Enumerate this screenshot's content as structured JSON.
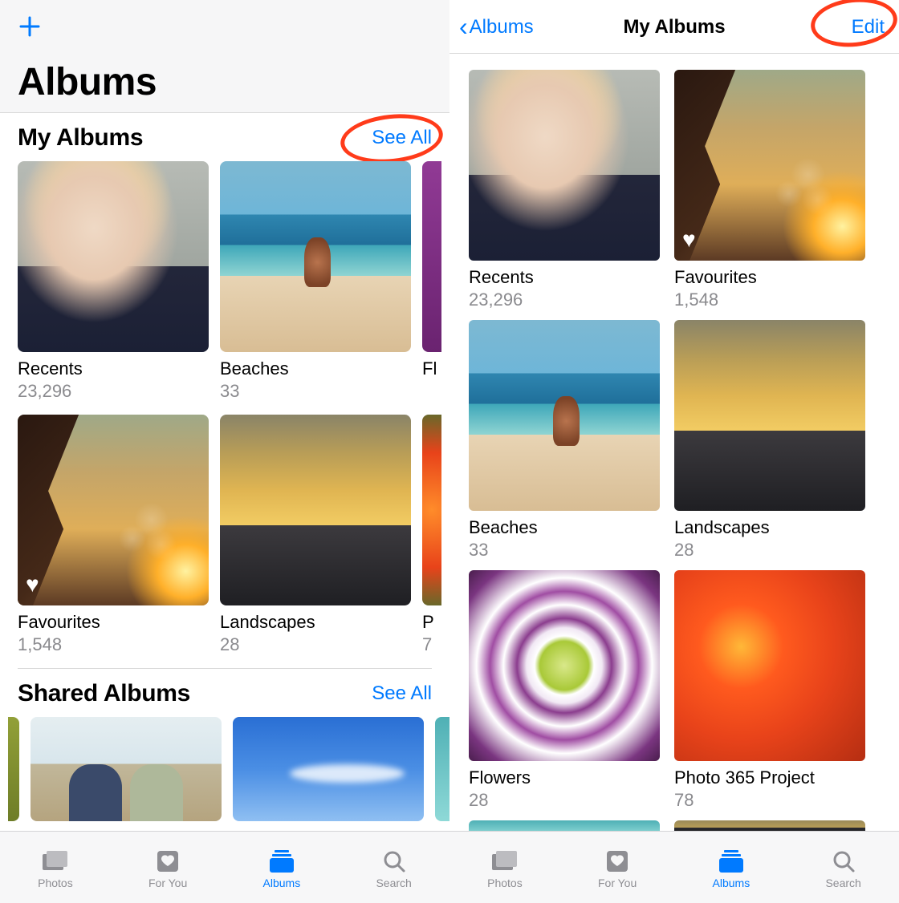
{
  "colors": {
    "accent": "#007aff",
    "annotation": "#ff3b1a",
    "muted": "#8e8e93"
  },
  "left": {
    "header_title": "Albums",
    "sections": {
      "my_albums": {
        "title": "My Albums",
        "see_all": "See All",
        "row1": [
          {
            "name": "Recents",
            "count": "23,296",
            "img": "img-portrait"
          },
          {
            "name": "Beaches",
            "count": "33",
            "img": "img-beach"
          },
          {
            "name_partial": "Fl",
            "count_partial": "",
            "img": "img-purple"
          }
        ],
        "row2": [
          {
            "name": "Favourites",
            "count": "1,548",
            "img": "img-fav",
            "heart": true
          },
          {
            "name": "Landscapes",
            "count": "28",
            "img": "img-land"
          },
          {
            "name_partial": "P",
            "count_partial": "7",
            "img": "img-oliveflower"
          }
        ]
      },
      "shared": {
        "title": "Shared Albums",
        "see_all": "See All"
      }
    }
  },
  "right": {
    "back_label": "Albums",
    "nav_title": "My Albums",
    "edit_label": "Edit",
    "albums": [
      {
        "name": "Recents",
        "count": "23,296",
        "img": "img-portrait"
      },
      {
        "name": "Favourites",
        "count": "1,548",
        "img": "img-fav",
        "heart": true
      },
      {
        "name": "Beaches",
        "count": "33",
        "img": "img-beach"
      },
      {
        "name": "Landscapes",
        "count": "28",
        "img": "img-land"
      },
      {
        "name": "Flowers",
        "count": "28",
        "img": "img-flower-p"
      },
      {
        "name": "Photo 365 Project",
        "count": "78",
        "img": "img-flower-o"
      }
    ]
  },
  "tabs": [
    {
      "label": "Photos",
      "icon": "photos-icon"
    },
    {
      "label": "For You",
      "icon": "foryou-icon"
    },
    {
      "label": "Albums",
      "icon": "albums-icon",
      "active": true
    },
    {
      "label": "Search",
      "icon": "search-icon"
    }
  ]
}
